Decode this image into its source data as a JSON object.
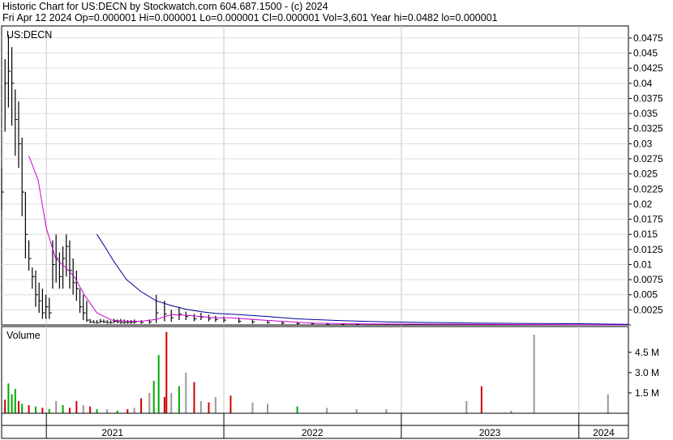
{
  "header": {
    "line1": "Historic Chart for US:DECN by Stockwatch.com 604.687.1500 - (c) 2024",
    "line2": "Fri Apr 12 2024   Op=0.000001   Hi=0.000001   Lo=0.000001   Cl=0.000001   Vol=3,601   Year hi=0.0482   lo=0.000001"
  },
  "chart_data": [
    {
      "type": "line",
      "title": "US:DECN",
      "price_axis": {
        "ylim": [
          0,
          0.0495
        ],
        "ticks": [
          0.0025,
          0.005,
          0.0075,
          0.01,
          0.0125,
          0.015,
          0.0175,
          0.02,
          0.0225,
          0.025,
          0.0275,
          0.03,
          0.0325,
          0.035,
          0.0375,
          0.04,
          0.0425,
          0.045,
          0.0475
        ],
        "tick_labels": [
          "0.0025",
          "0.005",
          "0.0075",
          "0.01",
          "0.0125",
          "0.015",
          "0.0175",
          "0.02",
          "0.0225",
          "0.025",
          "0.0275",
          "0.03",
          "0.0325",
          "0.035",
          "0.0375",
          "0.04",
          "0.0425",
          "0.045",
          "0.0475"
        ]
      },
      "x_axis": {
        "range": [
          "2020-10-01",
          "2024-04-12"
        ],
        "year_labels": [
          {
            "label": "2021",
            "start": "2020-10-01",
            "end": "2021-12-31"
          },
          {
            "label": "2022",
            "start": "2022-01-01",
            "end": "2022-12-31"
          },
          {
            "label": "2023",
            "start": "2023-01-01",
            "end": "2023-12-31"
          },
          {
            "label": "2024",
            "start": "2024-01-01",
            "end": "2024-04-12"
          }
        ],
        "gridlines": [
          "2021-01-01",
          "2022-01-01",
          "2023-01-01",
          "2024-01-01"
        ]
      },
      "series": [
        {
          "kind": "price",
          "color": "#000000",
          "x": [
            "2020-10-01",
            "2020-10-08",
            "2020-10-15",
            "2020-10-22",
            "2020-10-29",
            "2020-11-05",
            "2020-11-12",
            "2020-11-19",
            "2020-11-26",
            "2020-12-03",
            "2020-12-10",
            "2020-12-17",
            "2020-12-24",
            "2020-12-31",
            "2021-01-07",
            "2021-01-14",
            "2021-01-21",
            "2021-01-28",
            "2021-02-04",
            "2021-02-11",
            "2021-02-18",
            "2021-02-25",
            "2021-03-04",
            "2021-03-11",
            "2021-03-18",
            "2021-03-25",
            "2021-04-01",
            "2021-04-08",
            "2021-04-15",
            "2021-04-22",
            "2021-04-29",
            "2021-05-06",
            "2021-05-13",
            "2021-05-20",
            "2021-05-27",
            "2021-06-03",
            "2021-06-10",
            "2021-06-17",
            "2021-06-24",
            "2021-07-01",
            "2021-07-15",
            "2021-08-01",
            "2021-08-15",
            "2021-09-01",
            "2021-09-15",
            "2021-10-01",
            "2021-10-15",
            "2021-11-01",
            "2021-11-15",
            "2021-12-01",
            "2021-12-15",
            "2022-01-01",
            "2022-02-01",
            "2022-03-01",
            "2022-04-01",
            "2022-05-01",
            "2022-06-01",
            "2022-07-01",
            "2022-08-01",
            "2022-09-01",
            "2022-10-01",
            "2022-12-01",
            "2023-03-01",
            "2023-06-01",
            "2023-09-01",
            "2023-12-01",
            "2024-02-01",
            "2024-04-12"
          ],
          "high": [
            0.026,
            0.044,
            0.048,
            0.046,
            0.039,
            0.037,
            0.031,
            0.022,
            0.014,
            0.0095,
            0.009,
            0.007,
            0.006,
            0.005,
            0.0045,
            0.014,
            0.015,
            0.012,
            0.013,
            0.015,
            0.014,
            0.011,
            0.009,
            0.006,
            0.005,
            0.004,
            0.001,
            0.0008,
            0.0008,
            0.001,
            0.0009,
            0.0008,
            0.0007,
            0.001,
            0.0009,
            0.001,
            0.0009,
            0.0008,
            0.0008,
            0.0009,
            0.0008,
            0.0009,
            0.005,
            0.004,
            0.0025,
            0.003,
            0.0022,
            0.0018,
            0.002,
            0.0017,
            0.0015,
            0.0014,
            0.0012,
            0.001,
            0.0008,
            0.0006,
            0.0005,
            0.0004,
            0.0003,
            0.0002,
            0.0002,
            0.0001,
            0.0001,
            0.0001,
            0.0001,
            5e-05,
            3e-05,
            1e-06
          ],
          "low": [
            0.019,
            0.032,
            0.036,
            0.033,
            0.028,
            0.026,
            0.018,
            0.011,
            0.009,
            0.006,
            0.003,
            0.002,
            0.001,
            0.001,
            0.001,
            0.006,
            0.007,
            0.006,
            0.006,
            0.008,
            0.006,
            0.005,
            0.004,
            0.002,
            0.0008,
            0.0005,
            0.0003,
            0.0003,
            0.0002,
            0.0003,
            0.0003,
            0.0002,
            0.0002,
            0.0003,
            0.0003,
            0.0002,
            0.0002,
            0.0002,
            0.0002,
            0.0002,
            0.0002,
            0.0002,
            0.0003,
            0.0006,
            0.0005,
            0.0008,
            0.0008,
            0.0006,
            0.0008,
            0.0006,
            0.0005,
            0.0004,
            0.0003,
            0.0002,
            0.0002,
            0.0001,
            0.0001,
            0.0001,
            5e-05,
            5e-05,
            5e-05,
            2e-05,
            2e-05,
            1e-05,
            1e-05,
            5e-06,
            2e-06,
            1e-06
          ],
          "close": [
            0.022,
            0.04,
            0.042,
            0.04,
            0.034,
            0.03,
            0.022,
            0.015,
            0.011,
            0.008,
            0.005,
            0.004,
            0.002,
            0.003,
            0.002,
            0.01,
            0.011,
            0.008,
            0.011,
            0.013,
            0.009,
            0.007,
            0.006,
            0.003,
            0.002,
            0.0008,
            0.0005,
            0.0004,
            0.0004,
            0.0006,
            0.0005,
            0.0004,
            0.0004,
            0.0006,
            0.0005,
            0.0004,
            0.0004,
            0.0004,
            0.0004,
            0.0005,
            0.0004,
            0.0005,
            0.002,
            0.0018,
            0.0012,
            0.0018,
            0.0014,
            0.001,
            0.0013,
            0.001,
            0.0009,
            0.0008,
            0.0006,
            0.0005,
            0.0004,
            0.0003,
            0.0002,
            0.0002,
            0.0001,
            0.0001,
            0.0001,
            5e-05,
            5e-05,
            3e-05,
            3e-05,
            1e-05,
            5e-06,
            1e-06
          ]
        },
        {
          "kind": "moving-average-short",
          "color": "#cc00cc",
          "x": [
            "2020-11-26",
            "2020-12-15",
            "2021-01-01",
            "2021-01-20",
            "2021-02-10",
            "2021-03-01",
            "2021-03-20",
            "2021-04-15",
            "2021-05-15",
            "2021-06-15",
            "2021-07-15",
            "2021-08-15",
            "2021-09-15",
            "2021-10-15",
            "2021-11-15",
            "2021-12-15",
            "2022-01-15",
            "2022-03-01",
            "2022-05-01",
            "2022-07-01",
            "2022-09-01",
            "2022-12-01",
            "2023-06-01",
            "2024-01-01",
            "2024-04-12"
          ],
          "values": [
            0.028,
            0.024,
            0.016,
            0.011,
            0.0095,
            0.0078,
            0.005,
            0.002,
            0.0008,
            0.0006,
            0.0006,
            0.0009,
            0.0017,
            0.0016,
            0.0014,
            0.0012,
            0.0012,
            0.0009,
            0.0006,
            0.0003,
            0.0002,
            0.00015,
            0.0001,
            3e-05,
            1e-05
          ]
        },
        {
          "kind": "moving-average-long",
          "color": "#000099",
          "x": [
            "2021-04-15",
            "2021-05-01",
            "2021-05-20",
            "2021-06-15",
            "2021-07-15",
            "2021-08-15",
            "2021-09-15",
            "2021-10-15",
            "2021-11-15",
            "2021-12-15",
            "2022-02-01",
            "2022-04-01",
            "2022-06-01",
            "2022-09-01",
            "2022-12-01",
            "2023-06-01",
            "2024-01-01",
            "2024-04-12"
          ],
          "values": [
            0.015,
            0.013,
            0.0105,
            0.0075,
            0.0055,
            0.004,
            0.0032,
            0.0026,
            0.0022,
            0.0019,
            0.0017,
            0.0014,
            0.001,
            0.0007,
            0.0005,
            0.0003,
            0.0002,
            0.0001
          ]
        }
      ]
    },
    {
      "type": "bar",
      "title": "Volume",
      "ylim": [
        0,
        6400000
      ],
      "ticks": [
        1500000,
        3000000,
        4500000
      ],
      "tick_labels": [
        "1.5 M",
        "3.0 M",
        "4.5 M"
      ],
      "bar_colors": {
        "up": "#00aa00",
        "down": "#cc0000",
        "flat": "#999999"
      },
      "bars": [
        {
          "date": "2020-10-08",
          "volume": 1000000,
          "dir": "down"
        },
        {
          "date": "2020-10-15",
          "volume": 2200000,
          "dir": "up"
        },
        {
          "date": "2020-10-22",
          "volume": 1400000,
          "dir": "up"
        },
        {
          "date": "2020-10-29",
          "volume": 1800000,
          "dir": "up"
        },
        {
          "date": "2020-11-05",
          "volume": 900000,
          "dir": "down"
        },
        {
          "date": "2020-11-12",
          "volume": 700000,
          "dir": "up"
        },
        {
          "date": "2020-11-26",
          "volume": 600000,
          "dir": "down"
        },
        {
          "date": "2020-12-10",
          "volume": 500000,
          "dir": "up"
        },
        {
          "date": "2020-12-24",
          "volume": 400000,
          "dir": "down"
        },
        {
          "date": "2021-01-07",
          "volume": 300000,
          "dir": "up"
        },
        {
          "date": "2021-01-21",
          "volume": 900000,
          "dir": "flat"
        },
        {
          "date": "2021-02-04",
          "volume": 600000,
          "dir": "up"
        },
        {
          "date": "2021-02-18",
          "volume": 400000,
          "dir": "down"
        },
        {
          "date": "2021-03-04",
          "volume": 900000,
          "dir": "down"
        },
        {
          "date": "2021-03-18",
          "volume": 600000,
          "dir": "flat"
        },
        {
          "date": "2021-04-01",
          "volume": 500000,
          "dir": "down"
        },
        {
          "date": "2021-04-15",
          "volume": 300000,
          "dir": "up"
        },
        {
          "date": "2021-05-06",
          "volume": 300000,
          "dir": "flat"
        },
        {
          "date": "2021-05-27",
          "volume": 200000,
          "dir": "up"
        },
        {
          "date": "2021-06-17",
          "volume": 300000,
          "dir": "down"
        },
        {
          "date": "2021-07-01",
          "volume": 400000,
          "dir": "flat"
        },
        {
          "date": "2021-07-15",
          "volume": 1100000,
          "dir": "down"
        },
        {
          "date": "2021-08-01",
          "volume": 1500000,
          "dir": "flat"
        },
        {
          "date": "2021-08-10",
          "volume": 2400000,
          "dir": "up"
        },
        {
          "date": "2021-08-20",
          "volume": 4300000,
          "dir": "up"
        },
        {
          "date": "2021-09-01",
          "volume": 1200000,
          "dir": "down"
        },
        {
          "date": "2021-09-05",
          "volume": 6000000,
          "dir": "down"
        },
        {
          "date": "2021-09-15",
          "volume": 1500000,
          "dir": "flat"
        },
        {
          "date": "2021-10-01",
          "volume": 2000000,
          "dir": "up"
        },
        {
          "date": "2021-10-15",
          "volume": 3000000,
          "dir": "flat"
        },
        {
          "date": "2021-11-01",
          "volume": 2300000,
          "dir": "down"
        },
        {
          "date": "2021-11-15",
          "volume": 900000,
          "dir": "flat"
        },
        {
          "date": "2021-12-01",
          "volume": 800000,
          "dir": "down"
        },
        {
          "date": "2021-12-15",
          "volume": 1200000,
          "dir": "flat"
        },
        {
          "date": "2022-01-15",
          "volume": 1300000,
          "dir": "down"
        },
        {
          "date": "2022-03-01",
          "volume": 800000,
          "dir": "flat"
        },
        {
          "date": "2022-04-01",
          "volume": 700000,
          "dir": "flat"
        },
        {
          "date": "2022-06-01",
          "volume": 500000,
          "dir": "up"
        },
        {
          "date": "2022-08-01",
          "volume": 400000,
          "dir": "flat"
        },
        {
          "date": "2022-10-01",
          "volume": 300000,
          "dir": "flat"
        },
        {
          "date": "2022-12-01",
          "volume": 300000,
          "dir": "flat"
        },
        {
          "date": "2023-05-15",
          "volume": 900000,
          "dir": "flat"
        },
        {
          "date": "2023-06-15",
          "volume": 2000000,
          "dir": "down"
        },
        {
          "date": "2023-08-15",
          "volume": 200000,
          "dir": "flat"
        },
        {
          "date": "2023-10-01",
          "volume": 5800000,
          "dir": "flat"
        },
        {
          "date": "2024-03-01",
          "volume": 1400000,
          "dir": "flat"
        }
      ]
    }
  ]
}
